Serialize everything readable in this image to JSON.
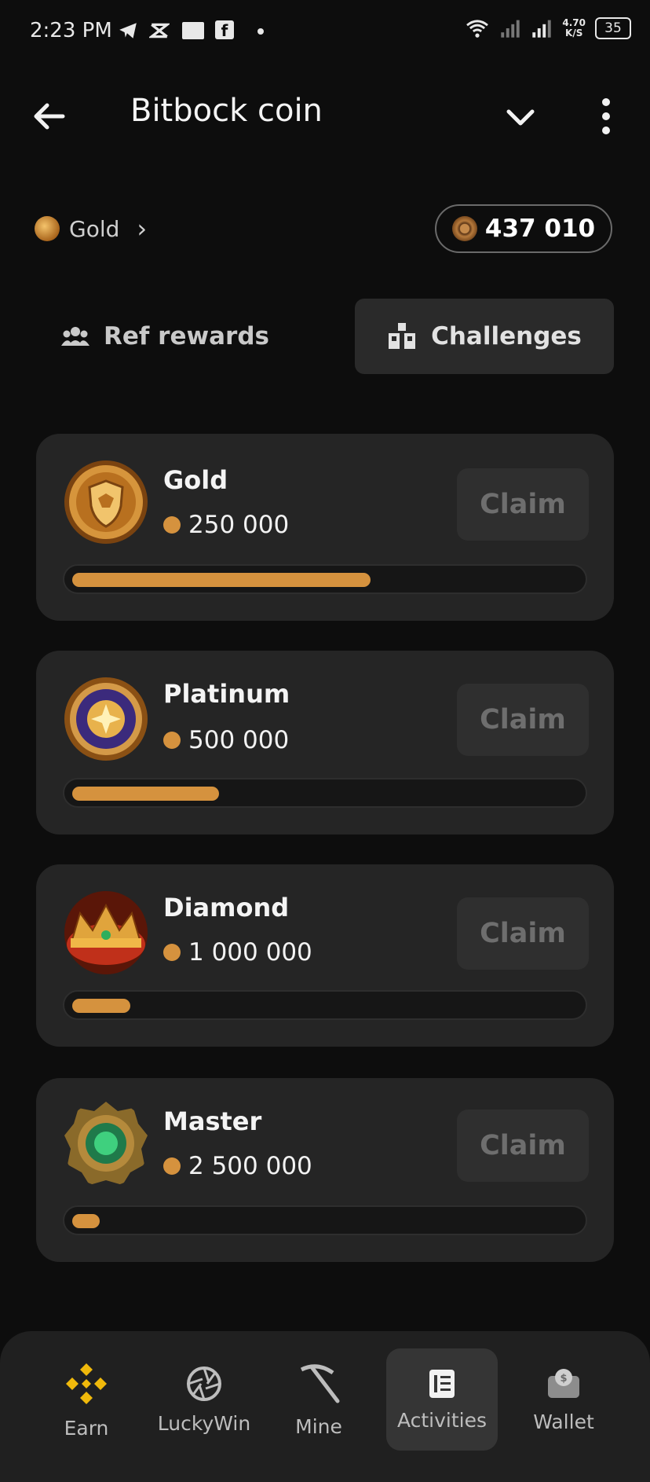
{
  "status_bar": {
    "time": "2:23 PM",
    "net_speed_value": "4.70",
    "net_speed_unit": "K/S",
    "battery": "35"
  },
  "header": {
    "title": "Bitbock coin"
  },
  "level": {
    "label": "Gold",
    "chevron": "›"
  },
  "balance": {
    "value": "437 010"
  },
  "tabs": [
    {
      "label": "Ref rewards",
      "icon": "users-icon",
      "active": false
    },
    {
      "label": "Challenges",
      "icon": "blocks-icon",
      "active": true
    }
  ],
  "challenges": [
    {
      "title": "Gold",
      "value": "250 000",
      "claim_label": "Claim",
      "progress": 0.59,
      "badge": "gold-shield-badge"
    },
    {
      "title": "Platinum",
      "value": "500 000",
      "claim_label": "Claim",
      "progress": 0.29,
      "badge": "platinum-star-badge"
    },
    {
      "title": "Diamond",
      "value": "1 000 000",
      "claim_label": "Claim",
      "progress": 0.115,
      "badge": "diamond-crown-badge"
    },
    {
      "title": "Master",
      "value": "2 500 000",
      "claim_label": "Claim",
      "progress": 0.055,
      "badge": "master-emerald-badge"
    }
  ],
  "nav": [
    {
      "label": "Earn",
      "icon": "binance-icon",
      "active": false
    },
    {
      "label": "LuckyWin",
      "icon": "aperture-icon",
      "active": false
    },
    {
      "label": "Mine",
      "icon": "pickaxe-icon",
      "active": false
    },
    {
      "label": "Activities",
      "icon": "document-icon",
      "active": true
    },
    {
      "label": "Wallet",
      "icon": "wallet-icon",
      "active": false
    }
  ],
  "colors": {
    "accent": "#d5923e",
    "background": "#0d0d0d",
    "card": "#252525"
  }
}
